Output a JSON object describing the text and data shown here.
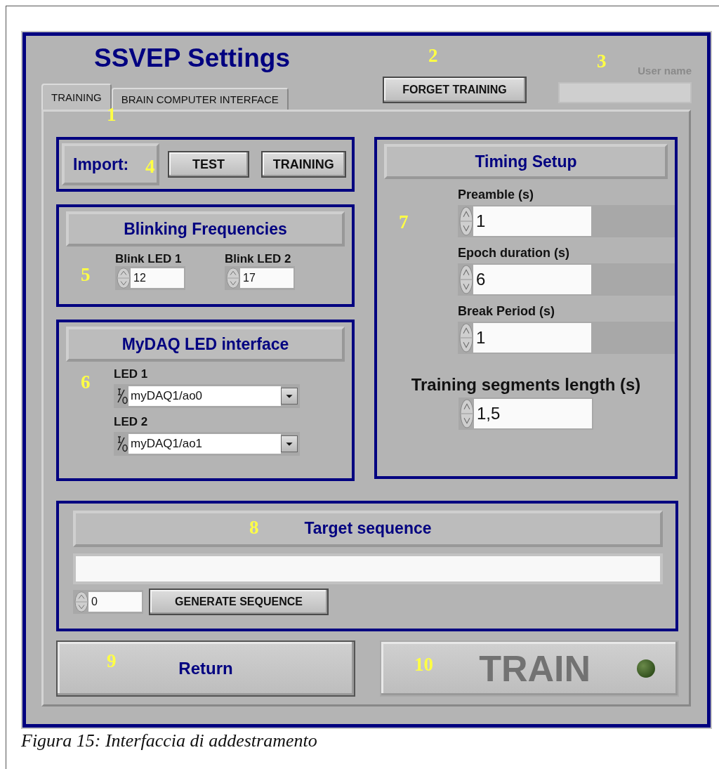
{
  "window": {
    "title": "SSVEP Settings"
  },
  "tabs": [
    {
      "label": "TRAINING",
      "selected": true
    },
    {
      "label": "BRAIN COMPUTER INTERFACE",
      "selected": false
    }
  ],
  "forget_button": "FORGET TRAINING",
  "user_name": {
    "label": "User name"
  },
  "import": {
    "label": "Import:",
    "buttons": [
      "TEST",
      "TRAINING"
    ]
  },
  "blinking": {
    "title": "Blinking Frequencies",
    "fields": [
      {
        "label": "Blink LED 1",
        "value": "12"
      },
      {
        "label": "Blink LED 2",
        "value": "17"
      }
    ]
  },
  "mydaq": {
    "title": "MyDAQ LED interface",
    "channels": [
      {
        "label": "LED 1",
        "value": "myDAQ1/ao0"
      },
      {
        "label": "LED 2",
        "value": "myDAQ1/ao1"
      }
    ]
  },
  "timing": {
    "title": "Timing Setup",
    "fields": [
      {
        "label": "Preamble (s)",
        "value": "1",
        "kind": "normal"
      },
      {
        "label": "Epoch duration (s)",
        "value": "6",
        "kind": "normal"
      },
      {
        "label": "Break Period (s)",
        "value": "1",
        "kind": "normal"
      },
      {
        "label": "Training segments length (s)",
        "value": "1,5",
        "kind": "large"
      }
    ]
  },
  "target": {
    "title": "Target sequence",
    "count": "0",
    "button": "GENERATE SEQUENCE"
  },
  "return_button": "Return",
  "train_button": {
    "label": "TRAIN",
    "disabled": true,
    "led_on": false
  },
  "callouts": [
    "1",
    "2",
    "3",
    "4",
    "5",
    "6",
    "7",
    "8",
    "9",
    "10"
  ],
  "caption": "Figura 15: Interfaccia di addestramento"
}
